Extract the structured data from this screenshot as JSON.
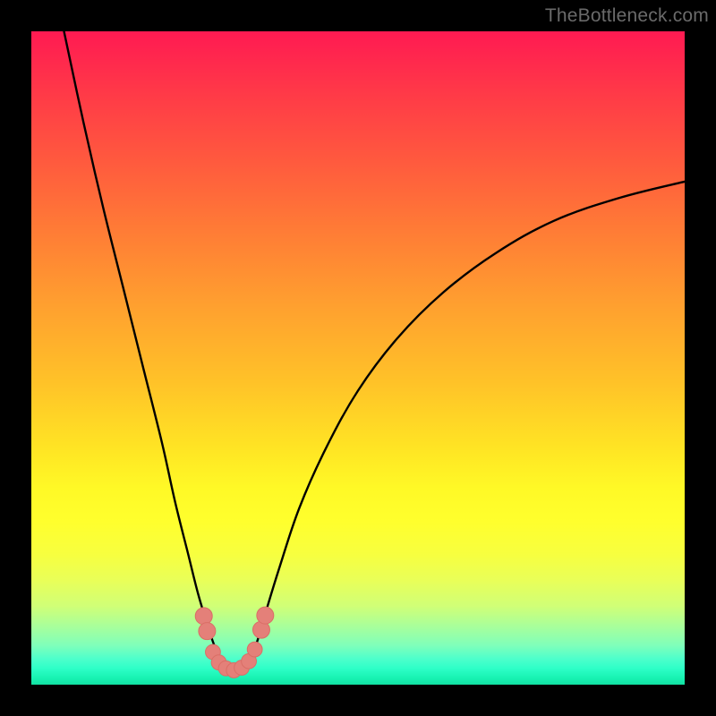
{
  "watermark": "TheBottleneck.com",
  "colors": {
    "frame": "#000000",
    "curve_stroke": "#000000",
    "marker_fill": "#e48079",
    "marker_stroke": "#da6e66"
  },
  "chart_data": {
    "type": "line",
    "title": "",
    "xlabel": "",
    "ylabel": "",
    "xlim": [
      0,
      100
    ],
    "ylim": [
      0,
      100
    ],
    "grid": false,
    "note": "Values are approximate percentages of plot area; y measured from bottom (0) to top (100). Curve is a V shape with rounded trough near x≈28–34.",
    "series": [
      {
        "name": "curve",
        "x": [
          5,
          8,
          11,
          14,
          17,
          20,
          22,
          24,
          25.5,
          27,
          28,
          29,
          30,
          31,
          32,
          33,
          34,
          35,
          36,
          38,
          41,
          45,
          50,
          56,
          63,
          71,
          80,
          90,
          100
        ],
        "y": [
          100,
          86,
          73,
          61,
          49,
          37,
          28,
          20,
          14,
          9,
          6,
          3.5,
          2.3,
          2,
          2.3,
          3.2,
          5,
          8,
          11.5,
          18,
          27,
          36,
          45,
          53,
          60,
          66,
          71,
          74.5,
          77
        ]
      }
    ],
    "markers": {
      "note": "Short beaded segment at trough",
      "points": [
        {
          "x": 26.4,
          "y": 10.5,
          "r": 1.3
        },
        {
          "x": 26.9,
          "y": 8.2,
          "r": 1.3
        },
        {
          "x": 27.8,
          "y": 5.0,
          "r": 1.15
        },
        {
          "x": 28.7,
          "y": 3.4,
          "r": 1.15
        },
        {
          "x": 29.8,
          "y": 2.5,
          "r": 1.15
        },
        {
          "x": 31.0,
          "y": 2.2,
          "r": 1.15
        },
        {
          "x": 32.2,
          "y": 2.6,
          "r": 1.15
        },
        {
          "x": 33.3,
          "y": 3.6,
          "r": 1.15
        },
        {
          "x": 34.2,
          "y": 5.4,
          "r": 1.15
        },
        {
          "x": 35.2,
          "y": 8.4,
          "r": 1.3
        },
        {
          "x": 35.8,
          "y": 10.6,
          "r": 1.3
        }
      ]
    }
  }
}
